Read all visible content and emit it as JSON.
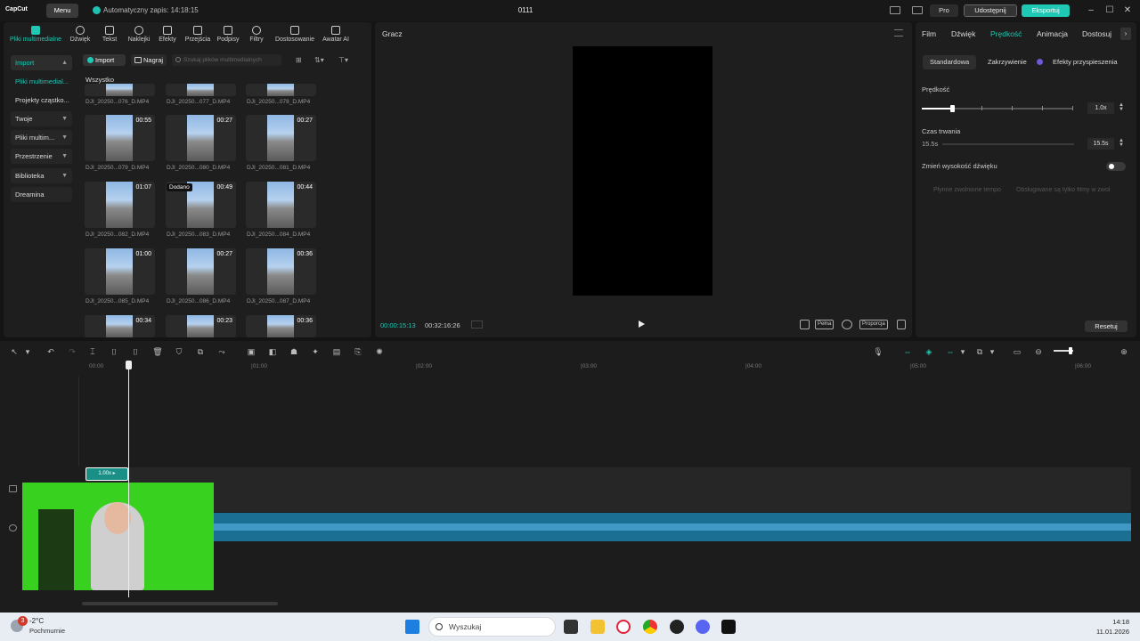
{
  "titlebar": {
    "logo": "CapCut",
    "menu_label": "Menu",
    "autosave": "Automatyczny zapis: 14:18:15",
    "project_title": "0111",
    "pro_label": "Pro",
    "share_label": "Udostępnij",
    "export_label": "Eksportuj"
  },
  "toolbar": {
    "items": [
      {
        "label": "Pliki multimedialne",
        "icon": "media-icon"
      },
      {
        "label": "Dźwięk",
        "icon": "audio-icon"
      },
      {
        "label": "Tekst",
        "icon": "text-icon"
      },
      {
        "label": "Naklejki",
        "icon": "sticker-icon"
      },
      {
        "label": "Efekty",
        "icon": "effects-icon"
      },
      {
        "label": "Przejścia",
        "icon": "transitions-icon"
      },
      {
        "label": "Podpisy",
        "icon": "captions-icon"
      },
      {
        "label": "Filtry",
        "icon": "filters-icon"
      },
      {
        "label": "Dostosowanie",
        "icon": "adjust-icon"
      },
      {
        "label": "Awatar AI",
        "icon": "avatar-icon"
      }
    ]
  },
  "sidebar": {
    "items": [
      {
        "label": "Import"
      },
      {
        "label": "Pliki multimedial..."
      },
      {
        "label": "Projekty cząstko..."
      },
      {
        "label": "Twoje"
      },
      {
        "label": "Pliki multim..."
      },
      {
        "label": "Przestrzenie"
      },
      {
        "label": "Biblioteka"
      },
      {
        "label": "Dreamina"
      }
    ]
  },
  "media": {
    "import_label": "Import",
    "record_label": "Nagraj",
    "search_placeholder": "Szukaj plików multimedialnych",
    "section_label": "Wszystko",
    "files": [
      {
        "name": "DJI_20250...076_D.MP4",
        "duration": ""
      },
      {
        "name": "DJI_20250...077_D.MP4",
        "duration": ""
      },
      {
        "name": "DJI_20250...078_D.MP4",
        "duration": ""
      },
      {
        "name": "DJI_20250...079_D.MP4",
        "duration": "00:55"
      },
      {
        "name": "DJI_20250...080_D.MP4",
        "duration": "00:27"
      },
      {
        "name": "DJI_20250...081_D.MP4",
        "duration": "00:27"
      },
      {
        "name": "DJI_20250...082_D.MP4",
        "duration": "01:07"
      },
      {
        "name": "DJI_20250...083_D.MP4",
        "duration": "00:49",
        "badge": "Dodano"
      },
      {
        "name": "DJI_20250...084_D.MP4",
        "duration": "00:44"
      },
      {
        "name": "DJI_20250...085_D.MP4",
        "duration": "01:00"
      },
      {
        "name": "DJI_20250...086_D.MP4",
        "duration": "00:27"
      },
      {
        "name": "DJI_20250...087_D.MP4",
        "duration": "00:36"
      },
      {
        "name": "",
        "duration": "00:34"
      },
      {
        "name": "",
        "duration": "00:23"
      },
      {
        "name": "",
        "duration": "00:36"
      }
    ]
  },
  "player": {
    "title": "Gracz",
    "current_time": "00:00:15:13",
    "total_time": "00:32:16:26",
    "full_label": "Pełna",
    "ratio_label": "Proporcja"
  },
  "inspector": {
    "tabs": [
      "Film",
      "Dźwięk",
      "Prędkość",
      "Animacja",
      "Dostosuj"
    ],
    "subtabs": [
      "Standardowa",
      "Zakrzywienie",
      "Efekty przyspieszenia"
    ],
    "speed_label": "Prędkość",
    "speed_value": "1.0x",
    "duration_label": "Czas trwania",
    "duration_left": "15.5s",
    "duration_value": "15.5s",
    "pitch_label": "Zmień wysokość dźwięku",
    "smooth_label": "Płynne zwolnione tempo",
    "smooth_note": "Obsługiwane są tylko filmy w zwol",
    "reset_label": "Resetuj"
  },
  "timeline": {
    "ruler": [
      "00:00",
      "|01:00",
      "|02:00",
      "|03:00",
      "|04:00",
      "|05:00",
      "|06:00"
    ],
    "clip_label": "1.00x ▸"
  },
  "taskbar": {
    "weather_badge": "3",
    "temperature": "-2°C",
    "weather": "Pochmurnie",
    "search_placeholder": "Wyszukaj",
    "time": "14:18",
    "date": "11.01.2026"
  },
  "colors": {
    "accent": "#1fc8b4",
    "audio_track": "#1a6f93",
    "webcam_green": "#39d11f"
  }
}
